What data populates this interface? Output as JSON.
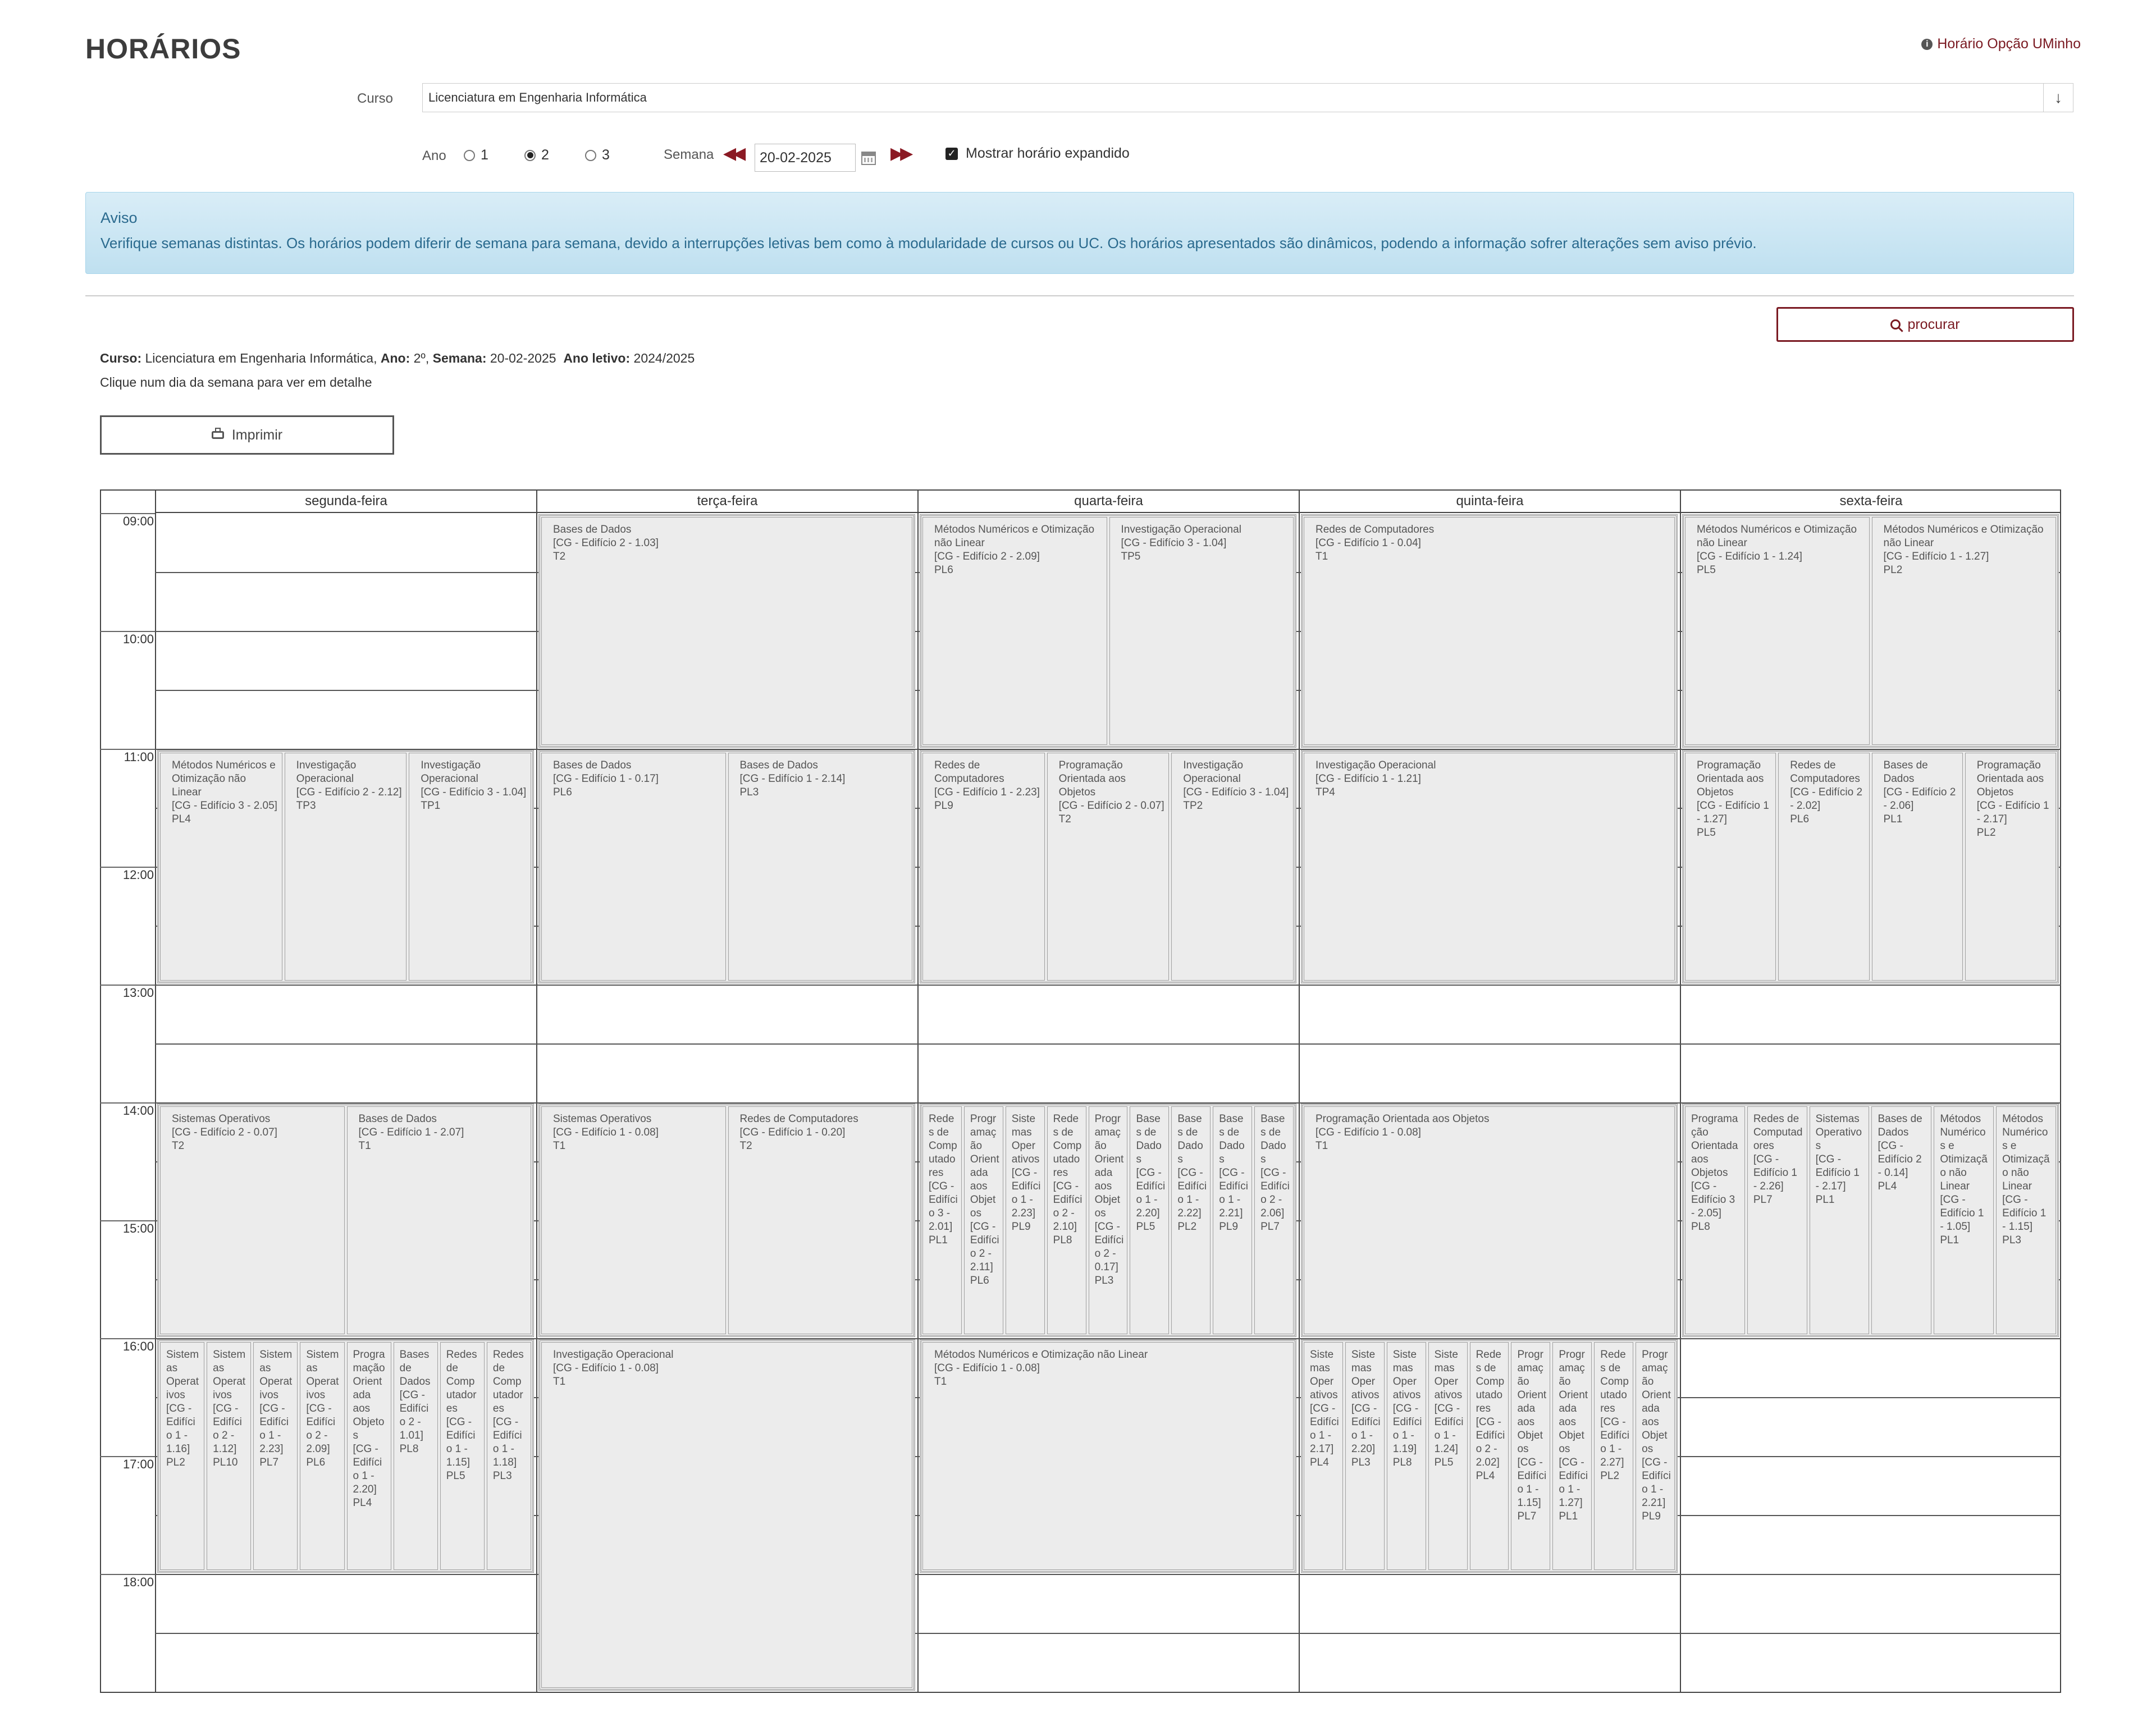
{
  "page": {
    "title": "HORÁRIOS",
    "opcao_link": "Horário Opção UMinho"
  },
  "filters": {
    "curso_label": "Curso",
    "curso_value": "Licenciatura em Engenharia Informática",
    "ano_label": "Ano",
    "ano_options": [
      "1",
      "2",
      "3"
    ],
    "ano_selected": "2",
    "semana_label": "Semana",
    "semana_value": "20-02-2025",
    "expand_label": "Mostrar horário expandido",
    "expand_checked": true
  },
  "aviso": {
    "title": "Aviso",
    "message": "Verifique semanas distintas. Os horários podem diferir de semana para semana, devido a interrupções letivas bem como à modularidade de cursos ou UC. Os horários apresentados são dinâmicos, podendo a informação sofrer alterações sem aviso prévio."
  },
  "actions": {
    "procurar": "procurar",
    "imprimir": "Imprimir"
  },
  "summary": {
    "curso_key": "Curso:",
    "curso_val": "Licenciatura em Engenharia Informática,",
    "ano_key": "Ano:",
    "ano_val": "2º,",
    "semana_key": "Semana:",
    "semana_val": "20-02-2025",
    "letivo_key": "Ano letivo:",
    "letivo_val": "2024/2025",
    "hint": "Clique num dia da semana para ver em detalhe"
  },
  "schedule": {
    "days": [
      "segunda-feira",
      "terça-feira",
      "quarta-feira",
      "quinta-feira",
      "sexta-feira"
    ],
    "times": [
      "09:00",
      "10:00",
      "11:00",
      "12:00",
      "13:00",
      "14:00",
      "15:00",
      "16:00",
      "17:00",
      "18:00"
    ],
    "blocks": [
      {
        "day": 0,
        "start": 11,
        "end": 13,
        "events": [
          {
            "name": "Métodos Numéricos e Otimização não Linear",
            "room": "[CG - Edifício 3 - 2.05]",
            "shift": "PL4"
          },
          {
            "name": "Investigação Operacional",
            "room": "[CG - Edifício 2 - 2.12]",
            "shift": "TP3"
          },
          {
            "name": "Investigação Operacional",
            "room": "[CG - Edifício 3 - 1.04]",
            "shift": "TP1"
          }
        ]
      },
      {
        "day": 0,
        "start": 14,
        "end": 16,
        "events": [
          {
            "name": "Sistemas Operativos",
            "room": "[CG - Edifício 2 - 0.07]",
            "shift": "T2"
          },
          {
            "name": "Bases de Dados",
            "room": "[CG - Edifício 1 - 2.07]",
            "shift": "T1"
          }
        ]
      },
      {
        "day": 0,
        "start": 16,
        "end": 18,
        "events": [
          {
            "name": "Sistemas Operativos",
            "room": "[CG - Edifício 1 - 1.16]",
            "shift": "PL2"
          },
          {
            "name": "Sistemas Operativos",
            "room": "[CG - Edifício 2 - 1.12]",
            "shift": "PL10"
          },
          {
            "name": "Sistemas Operativos",
            "room": "[CG - Edifício 1 - 2.23]",
            "shift": "PL7"
          },
          {
            "name": "Sistemas Operativos",
            "room": "[CG - Edifício 2 - 2.09]",
            "shift": "PL6"
          },
          {
            "name": "Programação Orientada aos Objetos",
            "room": "[CG - Edifício 1 - 2.20]",
            "shift": "PL4"
          },
          {
            "name": "Bases de Dados",
            "room": "[CG - Edifício 2 - 1.01]",
            "shift": "PL8"
          },
          {
            "name": "Redes de Computadores",
            "room": "[CG - Edifício 1 - 1.15]",
            "shift": "PL5"
          },
          {
            "name": "Redes de Computadores",
            "room": "[CG - Edifício 1 - 1.18]",
            "shift": "PL3"
          }
        ]
      },
      {
        "day": 1,
        "start": 9,
        "end": 11,
        "events": [
          {
            "name": "Bases de Dados",
            "room": "[CG - Edifício 2 - 1.03]",
            "shift": "T2"
          }
        ]
      },
      {
        "day": 1,
        "start": 11,
        "end": 13,
        "events": [
          {
            "name": "Bases de Dados",
            "room": "[CG - Edifício 1 - 0.17]",
            "shift": "PL6"
          },
          {
            "name": "Bases de Dados",
            "room": "[CG - Edifício 1 - 2.14]",
            "shift": "PL3"
          }
        ]
      },
      {
        "day": 1,
        "start": 14,
        "end": 16,
        "events": [
          {
            "name": "Sistemas Operativos",
            "room": "[CG - Edifício 1 - 0.08]",
            "shift": "T1"
          },
          {
            "name": "Redes de Computadores",
            "room": "[CG - Edifício 1 - 0.20]",
            "shift": "T2"
          }
        ]
      },
      {
        "day": 1,
        "start": 16,
        "end": 19,
        "events": [
          {
            "name": "Investigação Operacional",
            "room": "[CG - Edifício 1 - 0.08]",
            "shift": "T1"
          }
        ]
      },
      {
        "day": 2,
        "start": 9,
        "end": 11,
        "events": [
          {
            "name": "Métodos Numéricos e Otimização não Linear",
            "room": "[CG - Edifício 2 - 2.09]",
            "shift": "PL6"
          },
          {
            "name": "Investigação Operacional",
            "room": "[CG - Edifício 3 - 1.04]",
            "shift": "TP5"
          }
        ]
      },
      {
        "day": 2,
        "start": 11,
        "end": 13,
        "events": [
          {
            "name": "Redes de Computadores",
            "room": "[CG - Edifício 1 - 2.23]",
            "shift": "PL9"
          },
          {
            "name": "Programação Orientada aos Objetos",
            "room": "[CG - Edifício 2 - 0.07]",
            "shift": "T2"
          },
          {
            "name": "Investigação Operacional",
            "room": "[CG - Edifício 3 - 1.04]",
            "shift": "TP2"
          }
        ]
      },
      {
        "day": 2,
        "start": 14,
        "end": 16,
        "events": [
          {
            "name": "Redes de Computadores",
            "room": "[CG - Edifício 3 - 2.01]",
            "shift": "PL1"
          },
          {
            "name": "Programação Orientada aos Objetos",
            "room": "[CG - Edifício 2 - 2.11]",
            "shift": "PL6"
          },
          {
            "name": "Sistemas Operativos",
            "room": "[CG - Edifício 1 - 2.23]",
            "shift": "PL9"
          },
          {
            "name": "Redes de Computadores",
            "room": "[CG - Edifício 2 - 2.10]",
            "shift": "PL8"
          },
          {
            "name": "Programação Orientada aos Objetos",
            "room": "[CG - Edifício 2 - 0.17]",
            "shift": "PL3"
          },
          {
            "name": "Bases de Dados",
            "room": "[CG - Edifício 1 - 2.20]",
            "shift": "PL5"
          },
          {
            "name": "Bases de Dados",
            "room": "[CG - Edifício 1 - 2.22]",
            "shift": "PL2"
          },
          {
            "name": "Bases de Dados",
            "room": "[CG - Edifício 1 - 2.21]",
            "shift": "PL9"
          },
          {
            "name": "Bases de Dados",
            "room": "[CG - Edifício 2 - 2.06]",
            "shift": "PL7"
          }
        ]
      },
      {
        "day": 2,
        "start": 16,
        "end": 18,
        "events": [
          {
            "name": "Métodos Numéricos e Otimização não Linear",
            "room": "[CG - Edifício 1 - 0.08]",
            "shift": "T1"
          }
        ]
      },
      {
        "day": 3,
        "start": 9,
        "end": 11,
        "events": [
          {
            "name": "Redes de Computadores",
            "room": "[CG - Edifício 1 - 0.04]",
            "shift": "T1"
          }
        ]
      },
      {
        "day": 3,
        "start": 11,
        "end": 13,
        "events": [
          {
            "name": "Investigação Operacional",
            "room": "[CG - Edifício 1 - 1.21]",
            "shift": "TP4"
          }
        ]
      },
      {
        "day": 3,
        "start": 14,
        "end": 16,
        "events": [
          {
            "name": "Programação Orientada aos Objetos",
            "room": "[CG - Edifício 1 - 0.08]",
            "shift": "T1"
          }
        ]
      },
      {
        "day": 3,
        "start": 16,
        "end": 18,
        "events": [
          {
            "name": "Sistemas Operativos",
            "room": "[CG - Edifício 1 - 2.17]",
            "shift": "PL4"
          },
          {
            "name": "Sistemas Operativos",
            "room": "[CG - Edifício 1 - 2.20]",
            "shift": "PL3"
          },
          {
            "name": "Sistemas Operativos",
            "room": "[CG - Edifício 1 - 1.19]",
            "shift": "PL8"
          },
          {
            "name": "Sistemas Operativos",
            "room": "[CG - Edifício 1 - 1.24]",
            "shift": "PL5"
          },
          {
            "name": "Redes de Computadores",
            "room": "[CG - Edifício 2 - 2.02]",
            "shift": "PL4"
          },
          {
            "name": "Programação Orientada aos Objetos",
            "room": "[CG - Edifício 1 - 1.15]",
            "shift": "PL7"
          },
          {
            "name": "Programação Orientada aos Objetos",
            "room": "[CG - Edifício 1 - 1.27]",
            "shift": "PL1"
          },
          {
            "name": "Redes de Computadores",
            "room": "[CG - Edifício 1 - 2.27]",
            "shift": "PL2"
          },
          {
            "name": "Programação Orientada aos Objetos",
            "room": "[CG - Edifício 1 - 2.21]",
            "shift": "PL9"
          }
        ]
      },
      {
        "day": 4,
        "start": 9,
        "end": 11,
        "events": [
          {
            "name": "Métodos Numéricos e Otimização não Linear",
            "room": "[CG - Edifício 1 - 1.24]",
            "shift": "PL5"
          },
          {
            "name": "Métodos Numéricos e Otimização não Linear",
            "room": "[CG - Edifício 1 - 1.27]",
            "shift": "PL2"
          }
        ]
      },
      {
        "day": 4,
        "start": 11,
        "end": 13,
        "events": [
          {
            "name": "Programação Orientada aos Objetos",
            "room": "[CG - Edifício 1 - 1.27]",
            "shift": "PL5"
          },
          {
            "name": "Redes de Computadores",
            "room": "[CG - Edifício 2 - 2.02]",
            "shift": "PL6"
          },
          {
            "name": "Bases de Dados",
            "room": "[CG - Edifício 2 - 2.06]",
            "shift": "PL1"
          },
          {
            "name": "Programação Orientada aos Objetos",
            "room": "[CG - Edifício 1 - 2.17]",
            "shift": "PL2"
          }
        ]
      },
      {
        "day": 4,
        "start": 14,
        "end": 16,
        "events": [
          {
            "name": "Programação Orientada aos Objetos",
            "room": "[CG - Edifício 3 - 2.05]",
            "shift": "PL8"
          },
          {
            "name": "Redes de Computadores",
            "room": "[CG - Edifício 1 - 2.26]",
            "shift": "PL7"
          },
          {
            "name": "Sistemas Operativos",
            "room": "[CG - Edifício 1 - 2.17]",
            "shift": "PL1"
          },
          {
            "name": "Bases de Dados",
            "room": "[CG - Edifício 2 - 0.14]",
            "shift": "PL4"
          },
          {
            "name": "Métodos Numéricos e Otimização não Linear",
            "room": "[CG - Edifício 1 - 1.05]",
            "shift": "PL1"
          },
          {
            "name": "Métodos Numéricos e Otimização não Linear",
            "room": "[CG - Edifício 1 - 1.15]",
            "shift": "PL3"
          }
        ]
      }
    ]
  }
}
